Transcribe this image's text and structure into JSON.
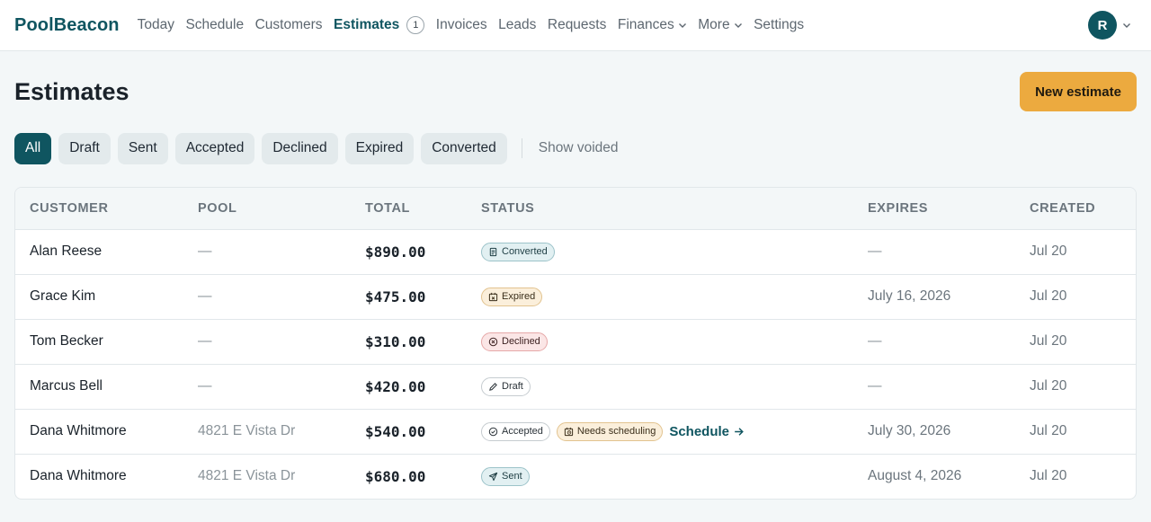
{
  "brand": "PoolBeacon",
  "nav": {
    "today": "Today",
    "schedule": "Schedule",
    "customers": "Customers",
    "estimates": "Estimates",
    "estimates_badge": "1",
    "invoices": "Invoices",
    "leads": "Leads",
    "requests": "Requests",
    "finances": "Finances",
    "more": "More",
    "settings": "Settings"
  },
  "user": {
    "avatar_initial": "R"
  },
  "page": {
    "title": "Estimates",
    "new_button": "New estimate"
  },
  "filters": {
    "all": "All",
    "draft": "Draft",
    "sent": "Sent",
    "accepted": "Accepted",
    "declined": "Declined",
    "expired": "Expired",
    "converted": "Converted",
    "show_voided": "Show voided"
  },
  "table": {
    "headers": {
      "customer": "CUSTOMER",
      "pool": "POOL",
      "total": "TOTAL",
      "status": "STATUS",
      "expires": "EXPIRES",
      "created": "CREATED"
    },
    "rows": [
      {
        "customer": "Alan Reese",
        "pool": "—",
        "total": "$890.00",
        "status": "Converted",
        "expires": "—",
        "created": "Jul 20"
      },
      {
        "customer": "Grace Kim",
        "pool": "—",
        "total": "$475.00",
        "status": "Expired",
        "expires": "July 16, 2026",
        "created": "Jul 20"
      },
      {
        "customer": "Tom Becker",
        "pool": "—",
        "total": "$310.00",
        "status": "Declined",
        "expires": "—",
        "created": "Jul 20"
      },
      {
        "customer": "Marcus Bell",
        "pool": "—",
        "total": "$420.00",
        "status": "Draft",
        "expires": "—",
        "created": "Jul 20"
      },
      {
        "customer": "Dana Whitmore",
        "pool": "4821 E Vista Dr",
        "total": "$540.00",
        "status": "Accepted",
        "extra_badge": "Needs scheduling",
        "action": "Schedule",
        "expires": "July 30, 2026",
        "created": "Jul 20"
      },
      {
        "customer": "Dana Whitmore",
        "pool": "4821 E Vista Dr",
        "total": "$680.00",
        "status": "Sent",
        "expires": "August 4, 2026",
        "created": "Jul 20"
      }
    ]
  },
  "colors": {
    "brand": "#0f5560",
    "accent_button": "#ecaa3f",
    "background": "#f3f7f8"
  },
  "icons": {
    "nav_dropdown": "chevron-down-icon",
    "converted": "document-icon",
    "expired": "calendar-x-icon",
    "declined": "circle-x-icon",
    "draft": "pencil-icon",
    "accepted": "circle-check-icon",
    "needs_scheduling": "calendar-clock-icon",
    "schedule_link": "arrow-right-icon",
    "sent": "paper-plane-icon"
  }
}
